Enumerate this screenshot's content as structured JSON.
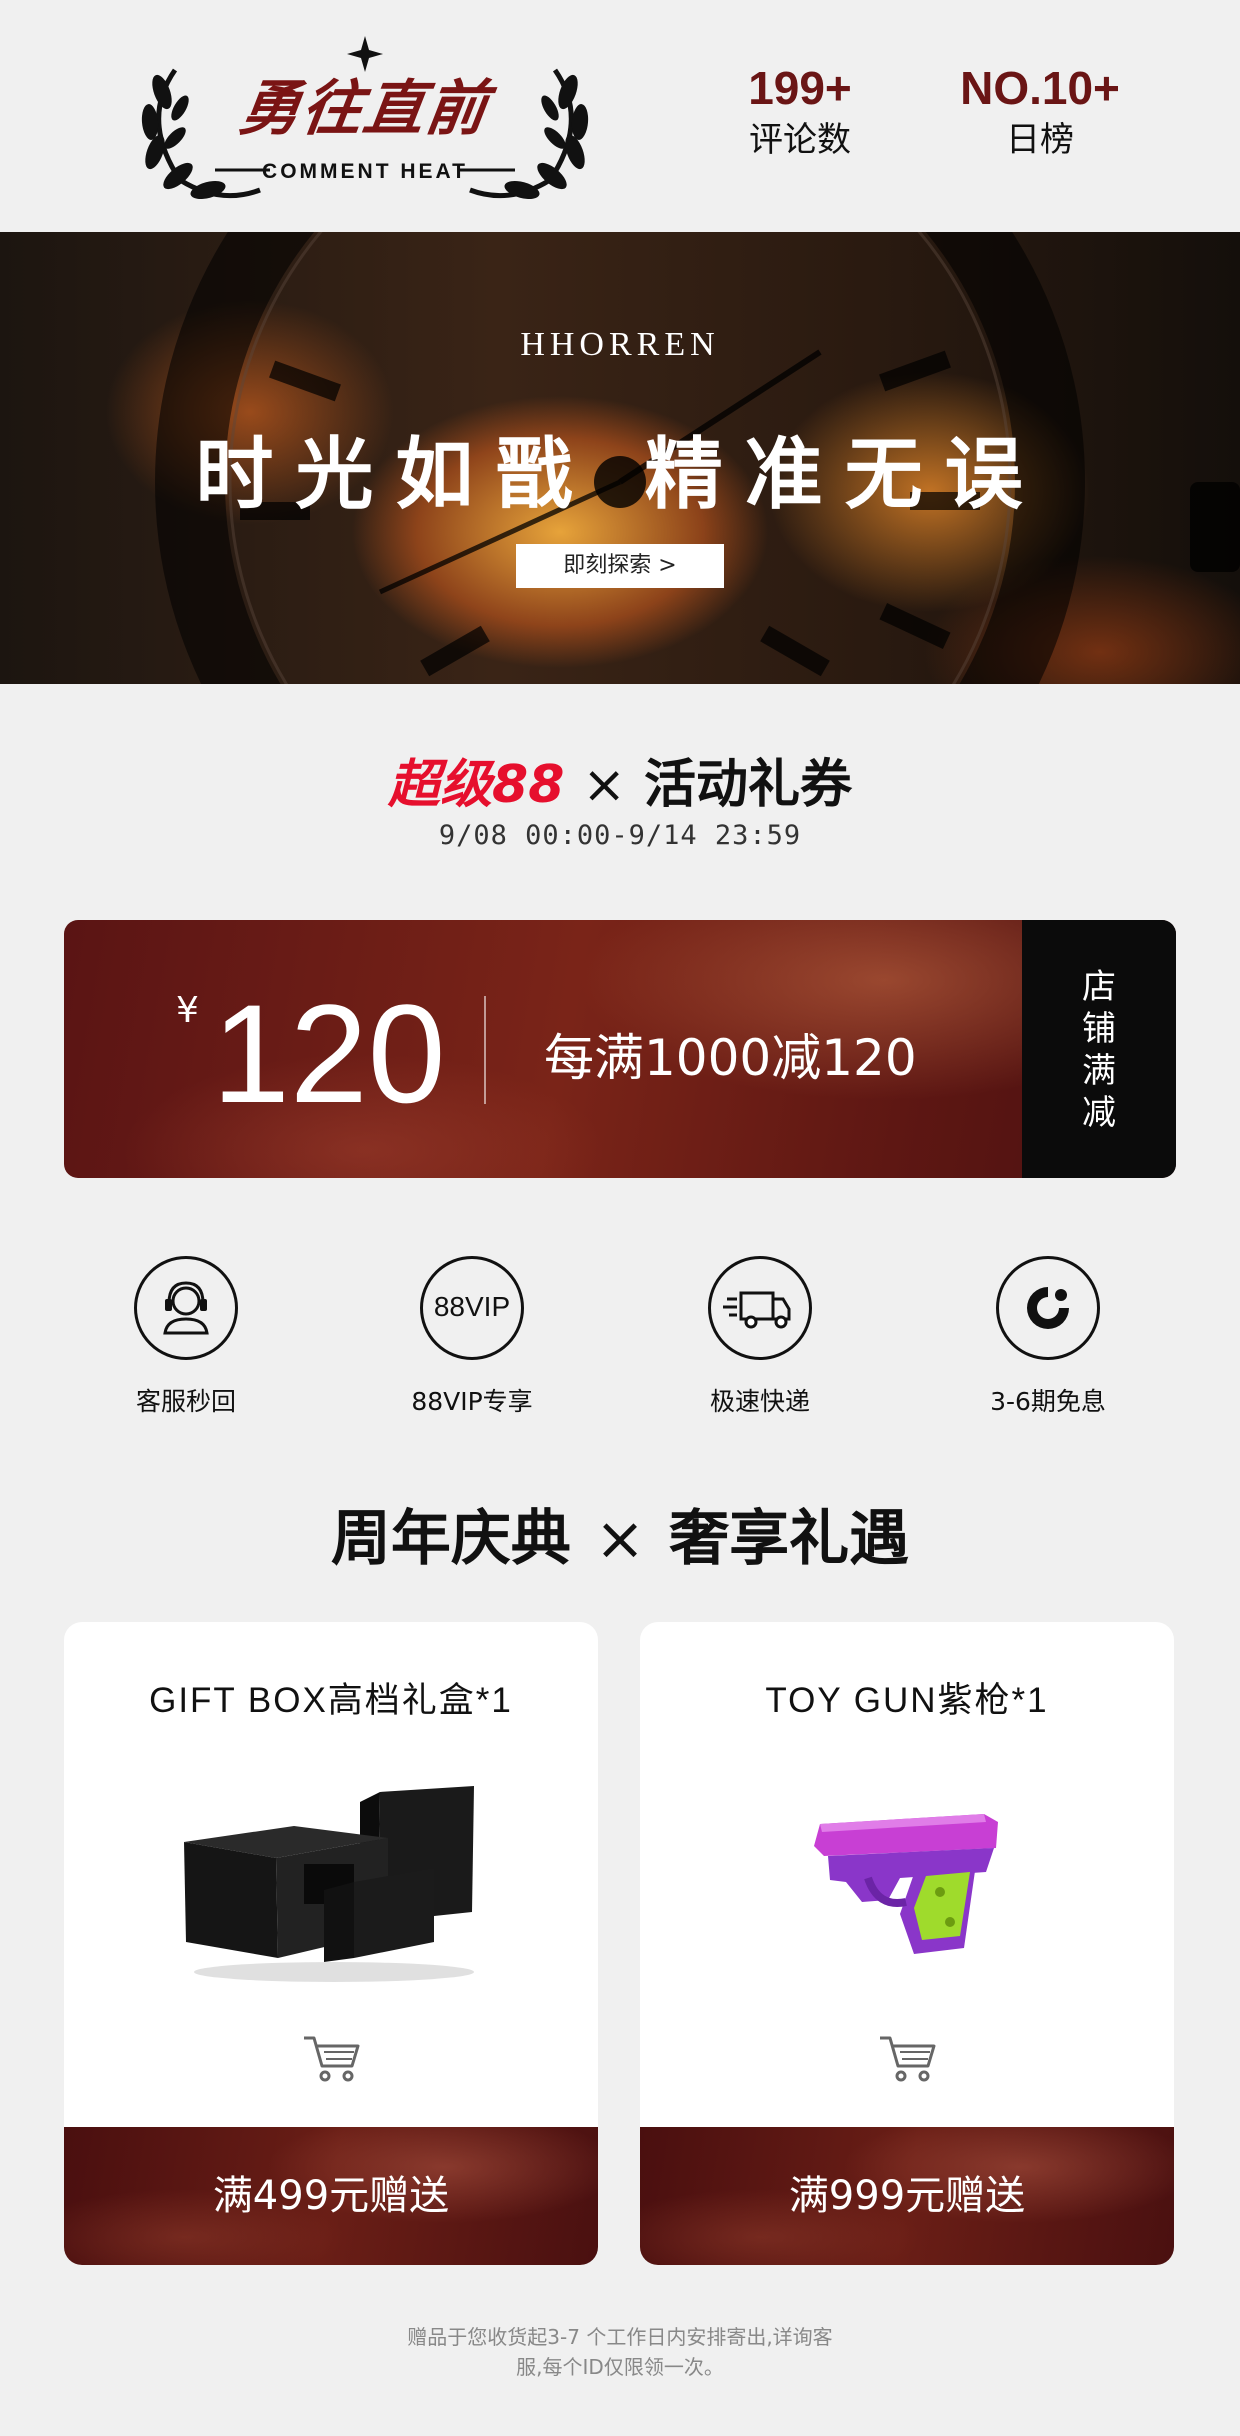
{
  "header": {
    "logo_title": "勇往直前",
    "logo_sub": "COMMENT HEAT",
    "stats": [
      {
        "value": "199+",
        "label": "评论数"
      },
      {
        "value": "NO.10+",
        "label": "日榜"
      }
    ]
  },
  "banner": {
    "brand": "HHORREN",
    "slogan": "时光如戬 精准无误",
    "button_label": "即刻探索 >"
  },
  "activity": {
    "super_label": "超级88",
    "times": "×",
    "name": "活动礼券",
    "date_range": "9/08 00:00-9/14 23:59"
  },
  "coupon": {
    "currency": "¥",
    "amount": "120",
    "description": "每满1000减120",
    "side_chars": [
      "店",
      "铺",
      "满",
      "减"
    ]
  },
  "services": [
    {
      "icon": "customer-service-icon",
      "label": "客服秒回"
    },
    {
      "icon": "88vip-icon",
      "label": "88VIP专享",
      "icon_text": "88VIP"
    },
    {
      "icon": "delivery-truck-icon",
      "label": "极速快递"
    },
    {
      "icon": "installment-icon",
      "label": "3-6期免息"
    }
  ],
  "gifts_section": {
    "left": "周年庆典",
    "times": "×",
    "right": "奢享礼遇"
  },
  "gifts": [
    {
      "name": "GIFT BOX高档礼盒*1",
      "condition": "满499元赠送",
      "icon": "gift-box-image"
    },
    {
      "name": "TOY GUN紫枪*1",
      "condition": "满999元赠送",
      "icon": "toy-gun-image"
    }
  ],
  "footnote": {
    "line1": "赠品于您收货起3-7 个工作日内安排寄出,详询客",
    "line2": "服,每个ID仅限领一次。"
  },
  "colors": {
    "accent_red": "#e60f2d",
    "maroon": "#6a1515",
    "coupon_dark": "#0b0b0b"
  }
}
